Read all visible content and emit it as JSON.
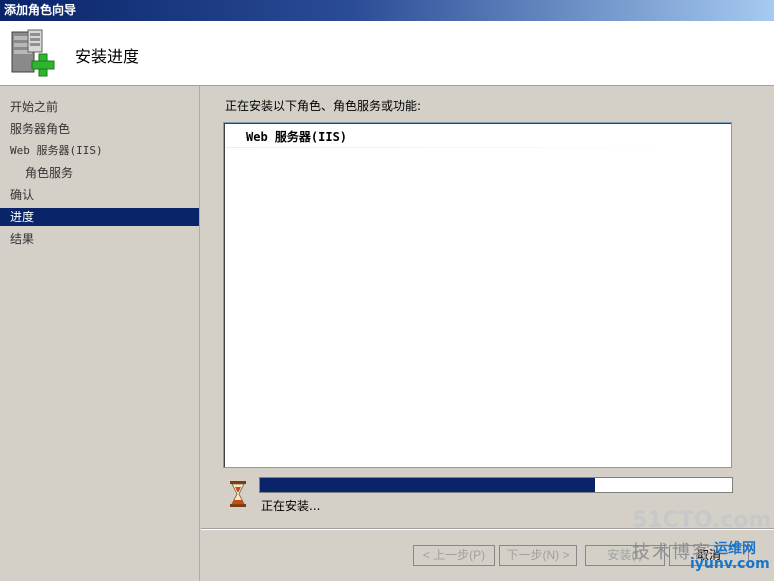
{
  "window": {
    "title": "添加角色向导"
  },
  "header": {
    "title": "安装进度"
  },
  "nav": {
    "items": [
      {
        "label": "开始之前",
        "sub": false,
        "active": false
      },
      {
        "label": "服务器角色",
        "sub": false,
        "active": false
      },
      {
        "label": "Web 服务器(IIS)",
        "sub": false,
        "active": false
      },
      {
        "label": "角色服务",
        "sub": true,
        "active": false
      },
      {
        "label": "确认",
        "sub": false,
        "active": false
      },
      {
        "label": "进度",
        "sub": false,
        "active": true
      },
      {
        "label": "结果",
        "sub": false,
        "active": false
      }
    ]
  },
  "content": {
    "label": "正在安装以下角色、角色服务或功能:",
    "list": [
      "Web 服务器(IIS)"
    ],
    "progress": 0.71,
    "status": "正在安装..."
  },
  "buttons": {
    "prev": "< 上一步(P)",
    "next": "下一步(N) >",
    "install": "安装(I)",
    "cancel": "取消"
  },
  "watermark": {
    "site": "51CTO.com",
    "blog": "技术博客",
    "ops": "运维网",
    "domain": "iyunv.com"
  },
  "colors": {
    "accent": "#0a246a",
    "background": "#d4d0c8"
  }
}
